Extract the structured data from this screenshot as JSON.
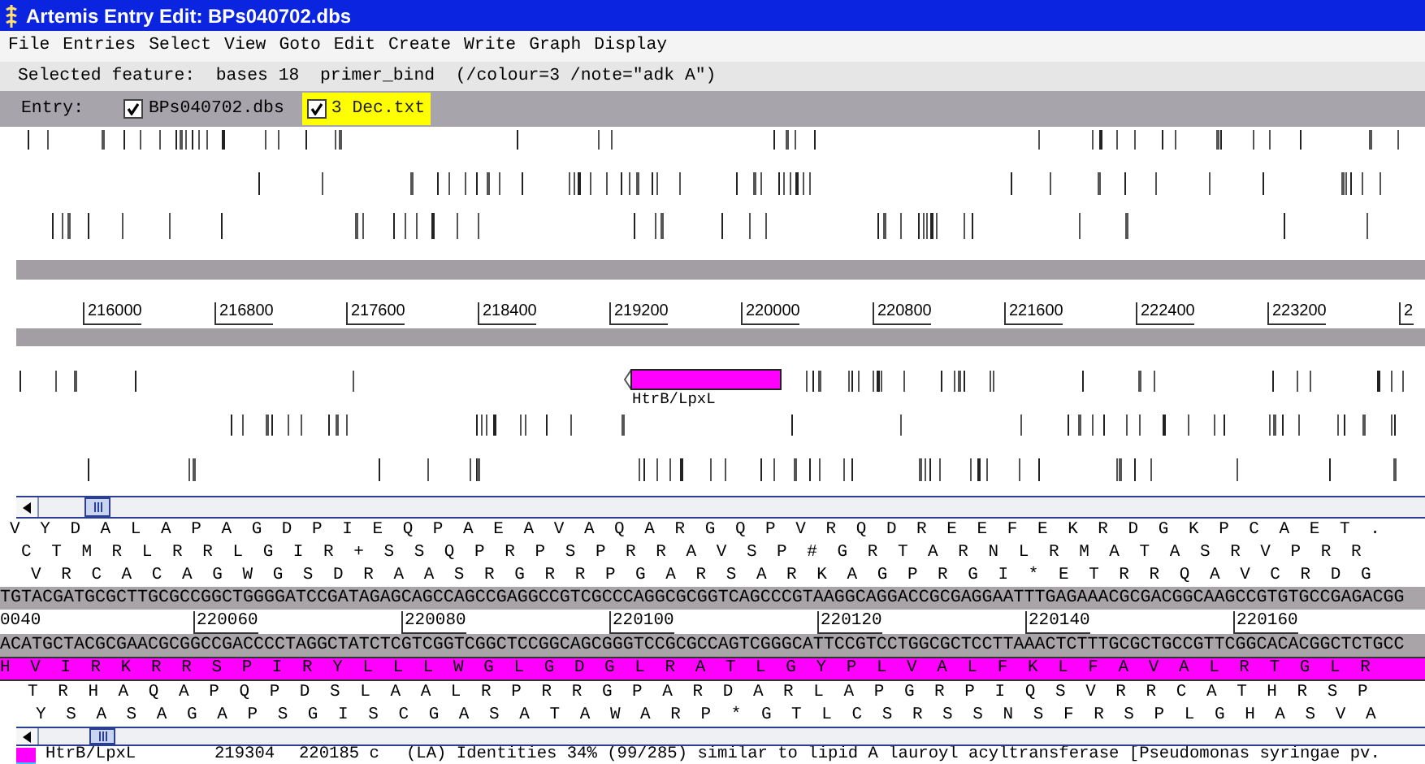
{
  "window": {
    "title": "Artemis Entry Edit: BPs040702.dbs"
  },
  "menu": [
    {
      "label": "File"
    },
    {
      "label": "Entries"
    },
    {
      "label": "Select"
    },
    {
      "label": "View"
    },
    {
      "label": "Goto"
    },
    {
      "label": "Edit"
    },
    {
      "label": "Create"
    },
    {
      "label": "Write"
    },
    {
      "label": "Graph"
    },
    {
      "label": "Display"
    }
  ],
  "selected_feature": "Selected feature:  bases 18  primer_bind  (/colour=3 /note=\"adk A\")",
  "entry_bar": {
    "label": "Entry:",
    "entries": [
      {
        "name": "BPs040702.dbs",
        "checked": true,
        "selected": false
      },
      {
        "name": "3 Dec.txt",
        "checked": true,
        "selected": true
      }
    ]
  },
  "overview": {
    "ruler_labels": [
      "216000",
      "216800",
      "217600",
      "218400",
      "219200",
      "220000",
      "220800",
      "221600",
      "222400",
      "223200",
      "2"
    ],
    "features": [
      {
        "label": "HtrB/LpxL"
      }
    ]
  },
  "sequence": {
    "forward_frames": [
      "V Y D A L A P A G D P I E Q P A E A V A Q A R G Q P V R Q D R E E F E K R D G K P C A E T .",
      "C T M R L R R L G I R + S S Q P R P S P R R A V S P # G R T A R N L R M A T A S R V P R R",
      "V R C A C A G W G S D R A A S R G R R P G A R S A R K A G P R G I * E T R R Q A V C R D G"
    ],
    "forward_dna": "TGTACGATGCGCTTGCGCCGGCTGGGGATCCGATAGAGCAGCCAGCCGAGGCCGTCGCCCAGGCGCGGTCAGCCCGTAAGGCAGGACCGCGAGGAATTTGAGAAACGCGACGGCAAGCCGTGTGCCGAGACGG",
    "ruler_labels": [
      "0040",
      "220060",
      "220080",
      "220100",
      "220120",
      "220140",
      "220160"
    ],
    "reverse_dna": "ACATGCTACGCGAACGCGGCCGACCCCTAGGCTATCTCGTCGGTCGGCTCCGGCAGCGGGTCCGCGCCAGTCGGGCATTCCGTCCTGGCGCTCCTTAAACTCTTTGCGCTGCCGTTCGGCACACGGCTCTGCC",
    "reverse_frames": [
      {
        "text": "H V I R K R R S P I R Y L L L W G L G D G L R A T L G Y P L V A L F K L F A V A L R T G L R",
        "selected": true
      },
      {
        "text": "T R H A Q A P Q P D S L A A L R P R R G P A R D A R L A P G R P I Q S V R R C A T H R S P",
        "selected": false
      },
      {
        "text": "Y S A S A G A P S G I S C G A S A T A W A R P * G T L C S R S S N S F R S P L G H A S V A",
        "selected": false
      }
    ]
  },
  "status": {
    "feature": "HtrB/LpxL",
    "start": "219304",
    "end": "220185 c",
    "description": "(LA) Identities 34% (99/285) similar to lipid A lauroyl acyltransferase [Pseudomonas syringae pv."
  }
}
